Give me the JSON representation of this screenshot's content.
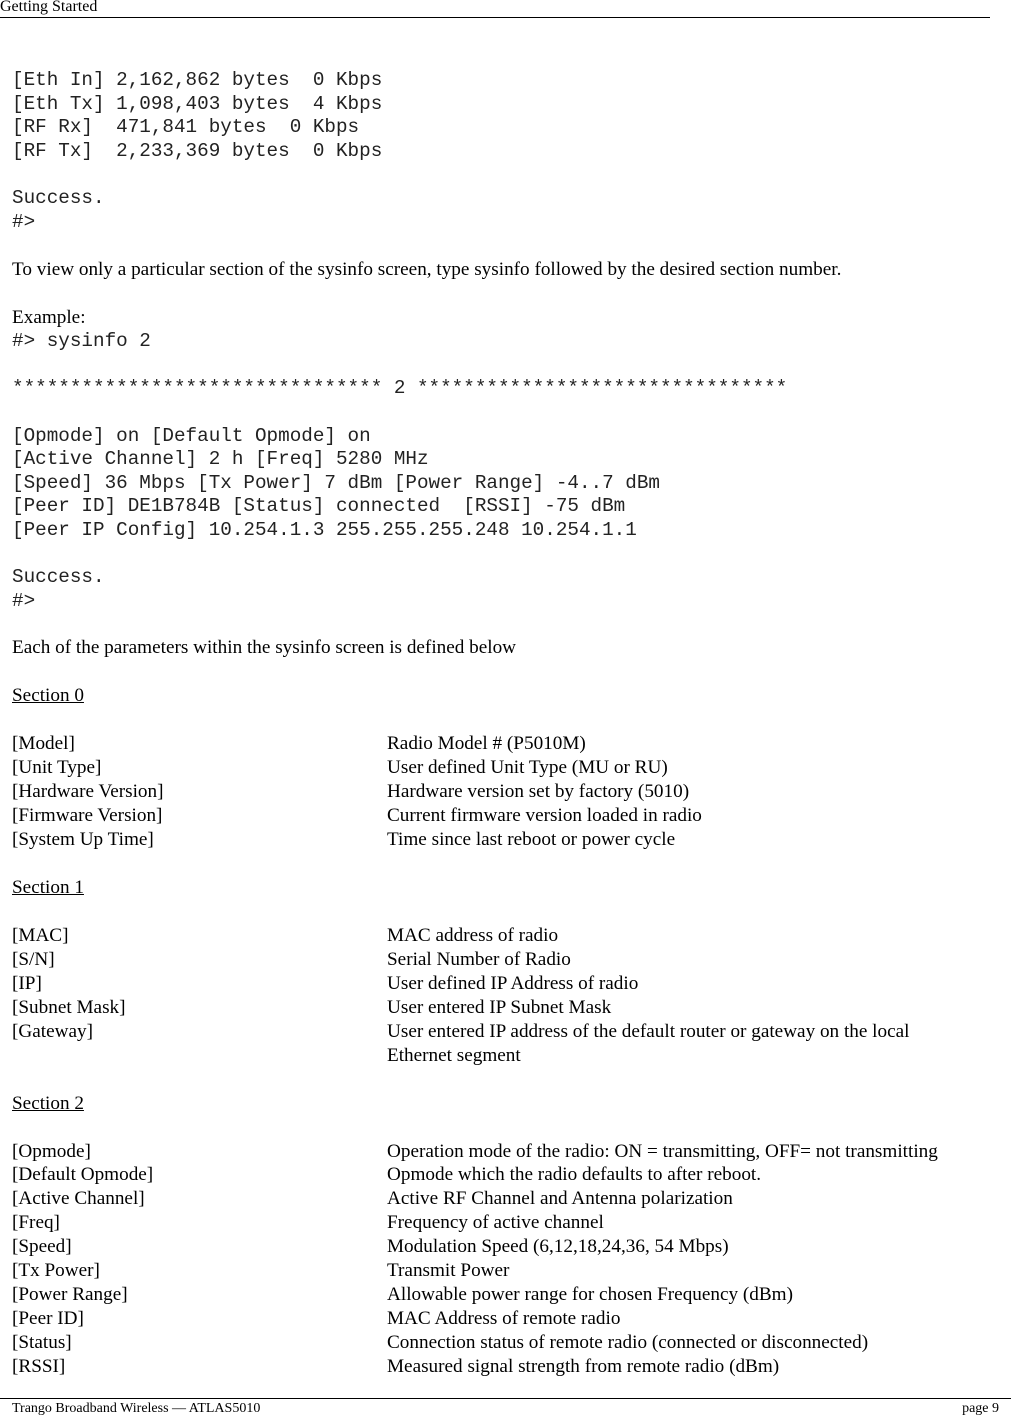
{
  "header": {
    "title": "Getting Started"
  },
  "footer": {
    "left": "Trango Broadband Wireless — ATLAS5010",
    "right": "page 9"
  },
  "traffic_output": {
    "lines": [
      "[Eth In] 2,162,862 bytes  0 Kbps",
      "[Eth Tx] 1,098,403 bytes  4 Kbps",
      "[RF Rx]  471,841 bytes  0 Kbps",
      "[RF Tx]  2,233,369 bytes  0 Kbps"
    ],
    "success": "Success.",
    "prompt": "#>"
  },
  "intro_paragraph": "To view only a particular section of the sysinfo screen, type sysinfo followed by the desired section number.",
  "example": {
    "label": "Example:",
    "command": "#> sysinfo 2",
    "banner": "******************************** 2 ********************************",
    "lines": [
      "[Opmode] on [Default Opmode] on",
      "[Active Channel] 2 h [Freq] 5280 MHz",
      "[Speed] 36 Mbps [Tx Power] 7 dBm [Power Range] -4..7 dBm",
      "[Peer ID] DE1B784B [Status] connected  [RSSI] -75 dBm",
      "[Peer IP Config] 10.254.1.3 255.255.255.248 10.254.1.1"
    ],
    "success": "Success.",
    "prompt": "#>"
  },
  "definitions_intro": "Each of the parameters within the sysinfo screen is defined below",
  "sections": [
    {
      "heading": "Section 0",
      "items": [
        {
          "term": "[Model]",
          "desc": "Radio Model # (P5010M)"
        },
        {
          "term": "[Unit Type]",
          "desc": "User defined Unit Type (MU or RU)"
        },
        {
          "term": "[Hardware Version]",
          "desc": "Hardware version set by factory (5010)"
        },
        {
          "term": "[Firmware Version]",
          "desc": "Current firmware version loaded in radio"
        },
        {
          "term": "[System Up Time]",
          "desc": "Time since last reboot or power cycle"
        }
      ]
    },
    {
      "heading": "Section 1",
      "items": [
        {
          "term": "[MAC]",
          "desc": "MAC address of radio"
        },
        {
          "term": "[S/N]",
          "desc": "Serial Number of Radio"
        },
        {
          "term": "[IP]",
          "desc": "User defined IP Address of radio"
        },
        {
          "term": "[Subnet Mask]",
          "desc": "User entered IP Subnet Mask"
        },
        {
          "term": "[Gateway]",
          "desc": "User entered IP address of the default router or gateway on the local Ethernet segment"
        }
      ]
    },
    {
      "heading": "Section 2",
      "items": [
        {
          "term": "[Opmode]",
          "desc": "Operation mode of the radio: ON = transmitting, OFF= not transmitting"
        },
        {
          "term": "[Default Opmode]",
          "desc": "Opmode which the radio defaults to after reboot."
        },
        {
          "term": "[Active Channel]",
          "desc": "Active RF Channel and Antenna polarization"
        },
        {
          "term": "[Freq]",
          "desc": "Frequency of active channel"
        },
        {
          "term": "[Speed]",
          "desc": "Modulation Speed (6,12,18,24,36, 54 Mbps)"
        },
        {
          "term": "[Tx Power]",
          "desc": "Transmit Power"
        },
        {
          "term": "[Power Range]",
          "desc": "Allowable power range for chosen Frequency (dBm)"
        },
        {
          "term": "[Peer ID]",
          "desc": "MAC Address of remote radio"
        },
        {
          "term": "[Status]",
          "desc": "Connection status of remote radio (connected or disconnected)"
        },
        {
          "term": "[RSSI]",
          "desc": "Measured signal strength from remote radio (dBm)"
        }
      ]
    }
  ]
}
